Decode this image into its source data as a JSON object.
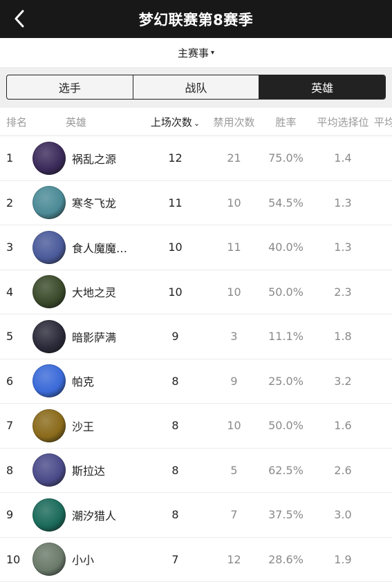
{
  "header": {
    "title": "梦幻联赛第8赛季",
    "back_icon": "chevron-left-icon"
  },
  "filter": {
    "label": "主赛事",
    "caret": "▾"
  },
  "tabs": [
    {
      "label": "选手",
      "active": false
    },
    {
      "label": "战队",
      "active": false
    },
    {
      "label": "英雄",
      "active": true
    }
  ],
  "columns": {
    "rank": "排名",
    "hero": "英雄",
    "played": "上场次数",
    "sort_caret": "⌄",
    "banned": "禁用次数",
    "winrate": "胜率",
    "avg_pick": "平均选择位",
    "extra": "平均"
  },
  "colors": {
    "header_bg": "#181818",
    "tab_active_bg": "#222222",
    "muted_text": "#8a8a8a"
  },
  "rows": [
    {
      "rank": "1",
      "hero": "祸乱之源",
      "played": "12",
      "banned": "21",
      "winrate": "75.0%",
      "avg_pick": "1.4",
      "avatar_color": "#3a2a5a"
    },
    {
      "rank": "2",
      "hero": "寒冬飞龙",
      "played": "11",
      "banned": "10",
      "winrate": "54.5%",
      "avg_pick": "1.3",
      "avatar_color": "#4a8a96"
    },
    {
      "rank": "3",
      "hero": "食人魔魔…",
      "played": "10",
      "banned": "11",
      "winrate": "40.0%",
      "avg_pick": "1.3",
      "avatar_color": "#4a5a9a"
    },
    {
      "rank": "4",
      "hero": "大地之灵",
      "played": "10",
      "banned": "10",
      "winrate": "50.0%",
      "avg_pick": "2.3",
      "avatar_color": "#3a4a2a"
    },
    {
      "rank": "5",
      "hero": "暗影萨满",
      "played": "9",
      "banned": "3",
      "winrate": "11.1%",
      "avg_pick": "1.8",
      "avatar_color": "#2a2a3a"
    },
    {
      "rank": "6",
      "hero": "帕克",
      "played": "8",
      "banned": "9",
      "winrate": "25.0%",
      "avg_pick": "3.2",
      "avatar_color": "#3a6ad8"
    },
    {
      "rank": "7",
      "hero": "沙王",
      "played": "8",
      "banned": "10",
      "winrate": "50.0%",
      "avg_pick": "1.6",
      "avatar_color": "#8a6a1a"
    },
    {
      "rank": "8",
      "hero": "斯拉达",
      "played": "8",
      "banned": "5",
      "winrate": "62.5%",
      "avg_pick": "2.6",
      "avatar_color": "#4a4a8a"
    },
    {
      "rank": "9",
      "hero": "潮汐猎人",
      "played": "8",
      "banned": "7",
      "winrate": "37.5%",
      "avg_pick": "3.0",
      "avatar_color": "#1a6a5a"
    },
    {
      "rank": "10",
      "hero": "小小",
      "played": "7",
      "banned": "12",
      "winrate": "28.6%",
      "avg_pick": "1.9",
      "avatar_color": "#6a7a6a"
    }
  ]
}
